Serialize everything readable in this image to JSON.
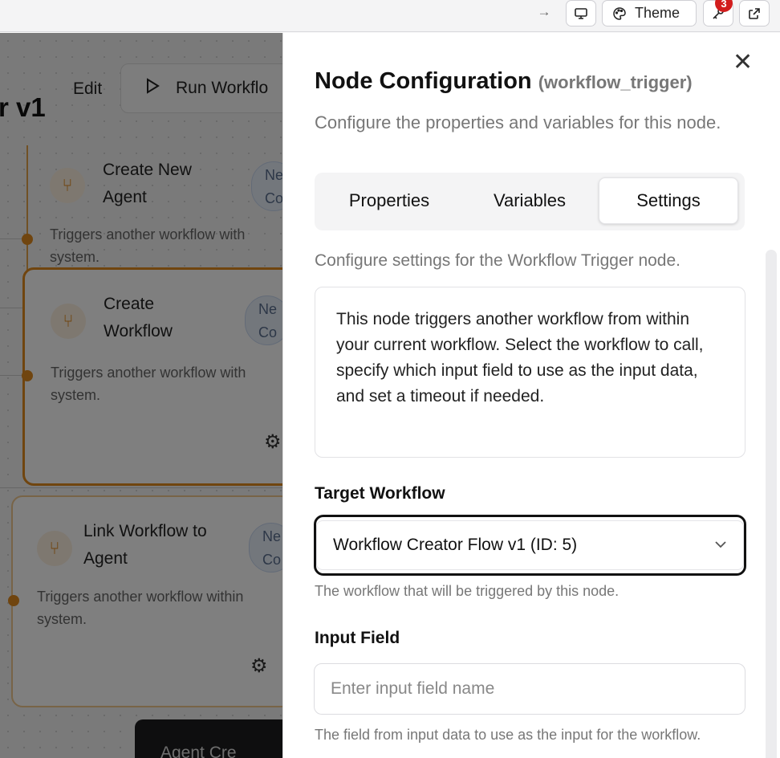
{
  "browser": {
    "forward_arrow": "→",
    "theme_label": "Theme",
    "notification_count": "3",
    "icons": [
      "monitor-icon",
      "palette-icon",
      "key-icon",
      "external-link-icon"
    ]
  },
  "canvas": {
    "title": "r v1",
    "edit_label": "Edit",
    "run_label": "Run Workflo",
    "nodes": [
      {
        "title": "Create New Agent",
        "desc": "Triggers another workflow with system.",
        "pill": "Ne Co"
      },
      {
        "title": "Create Workflow",
        "desc": "Triggers another workflow with system.",
        "pill": "Ne Co"
      },
      {
        "title": "Link Workflow to Agent",
        "desc": "Triggers another workflow within system.",
        "pill": "Ne Co"
      }
    ],
    "agent_chip": "Agent Cre"
  },
  "panel": {
    "title": "Node Configuration",
    "node_type": "(workflow_trigger)",
    "description": "Configure the properties and variables for this node.",
    "tabs": [
      "Properties",
      "Variables",
      "Settings"
    ],
    "active_tab": "Settings",
    "settings_description": "Configure settings for the Workflow Trigger node.",
    "info_text": "This node triggers another workflow from within your current workflow. Select the workflow to call, specify which input field to use as the input data, and set a timeout if needed.",
    "target_workflow": {
      "label": "Target Workflow",
      "value": "Workflow Creator Flow v1 (ID: 5)",
      "hint": "The workflow that will be triggered by this node."
    },
    "input_field": {
      "label": "Input Field",
      "placeholder": "Enter input field name",
      "value": "",
      "hint": "The field from input data to use as the input for the workflow."
    }
  },
  "colors": {
    "accent_orange": "#e08a1e",
    "badge_red": "#d21d1d"
  }
}
